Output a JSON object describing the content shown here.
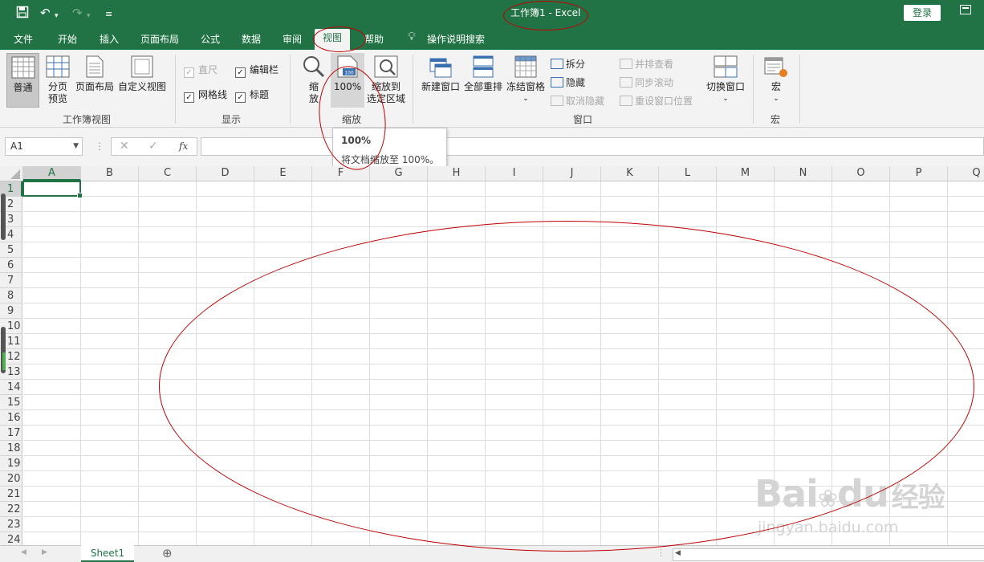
{
  "window": {
    "title": "工作簿1  -  Excel",
    "login": "登录"
  },
  "tabs": [
    "文件",
    "开始",
    "插入",
    "页面布局",
    "公式",
    "数据",
    "审阅",
    "视图",
    "帮助"
  ],
  "tell_me": "操作说明搜索",
  "ribbon": {
    "workbook_views": {
      "label": "工作簿视图",
      "normal": "普通",
      "page_break_1": "分页",
      "page_break_2": "预览",
      "page_layout": "页面布局",
      "custom": "自定义视图"
    },
    "show": {
      "label": "显示",
      "ruler": "直尺",
      "formula_bar": "编辑栏",
      "gridlines": "网格线",
      "headings": "标题"
    },
    "zoom": {
      "label": "缩放",
      "zoom_1": "缩",
      "zoom_2": "放",
      "hundred": "100%",
      "sel_1": "缩放到",
      "sel_2": "选定区域",
      "icon_text": "100"
    },
    "window": {
      "label": "窗口",
      "new": "新建窗口",
      "arrange": "全部重排",
      "freeze": "冻结窗格",
      "split": "拆分",
      "hide": "隐藏",
      "unhide": "取消隐藏",
      "side": "并排查看",
      "sync": "同步滚动",
      "reset": "重设窗口位置",
      "switch": "切换窗口"
    },
    "macros": {
      "label": "宏",
      "macro": "宏"
    }
  },
  "tooltip": {
    "title": "100%",
    "desc": "将文档缩放至 100%。"
  },
  "formula_bar": {
    "name_box": "A1",
    "fx": "fx"
  },
  "grid": {
    "columns": [
      "A",
      "B",
      "C",
      "D",
      "E",
      "F",
      "G",
      "H",
      "I",
      "J",
      "K",
      "L",
      "M",
      "N",
      "O",
      "P",
      "Q"
    ],
    "rows": [
      "1",
      "2",
      "3",
      "4",
      "5",
      "6",
      "7",
      "8",
      "9",
      "10",
      "11",
      "12",
      "13",
      "14",
      "15",
      "16",
      "17",
      "18",
      "19",
      "20",
      "21",
      "22",
      "23",
      "24"
    ]
  },
  "sheets": {
    "active": "Sheet1",
    "add": "⊕"
  },
  "watermark": {
    "brand": "Bai",
    "brand2": "du",
    "cn": "经验",
    "url": "jingyan.baidu.com"
  },
  "colors": {
    "accent": "#217346",
    "annotation": "#c00000"
  }
}
